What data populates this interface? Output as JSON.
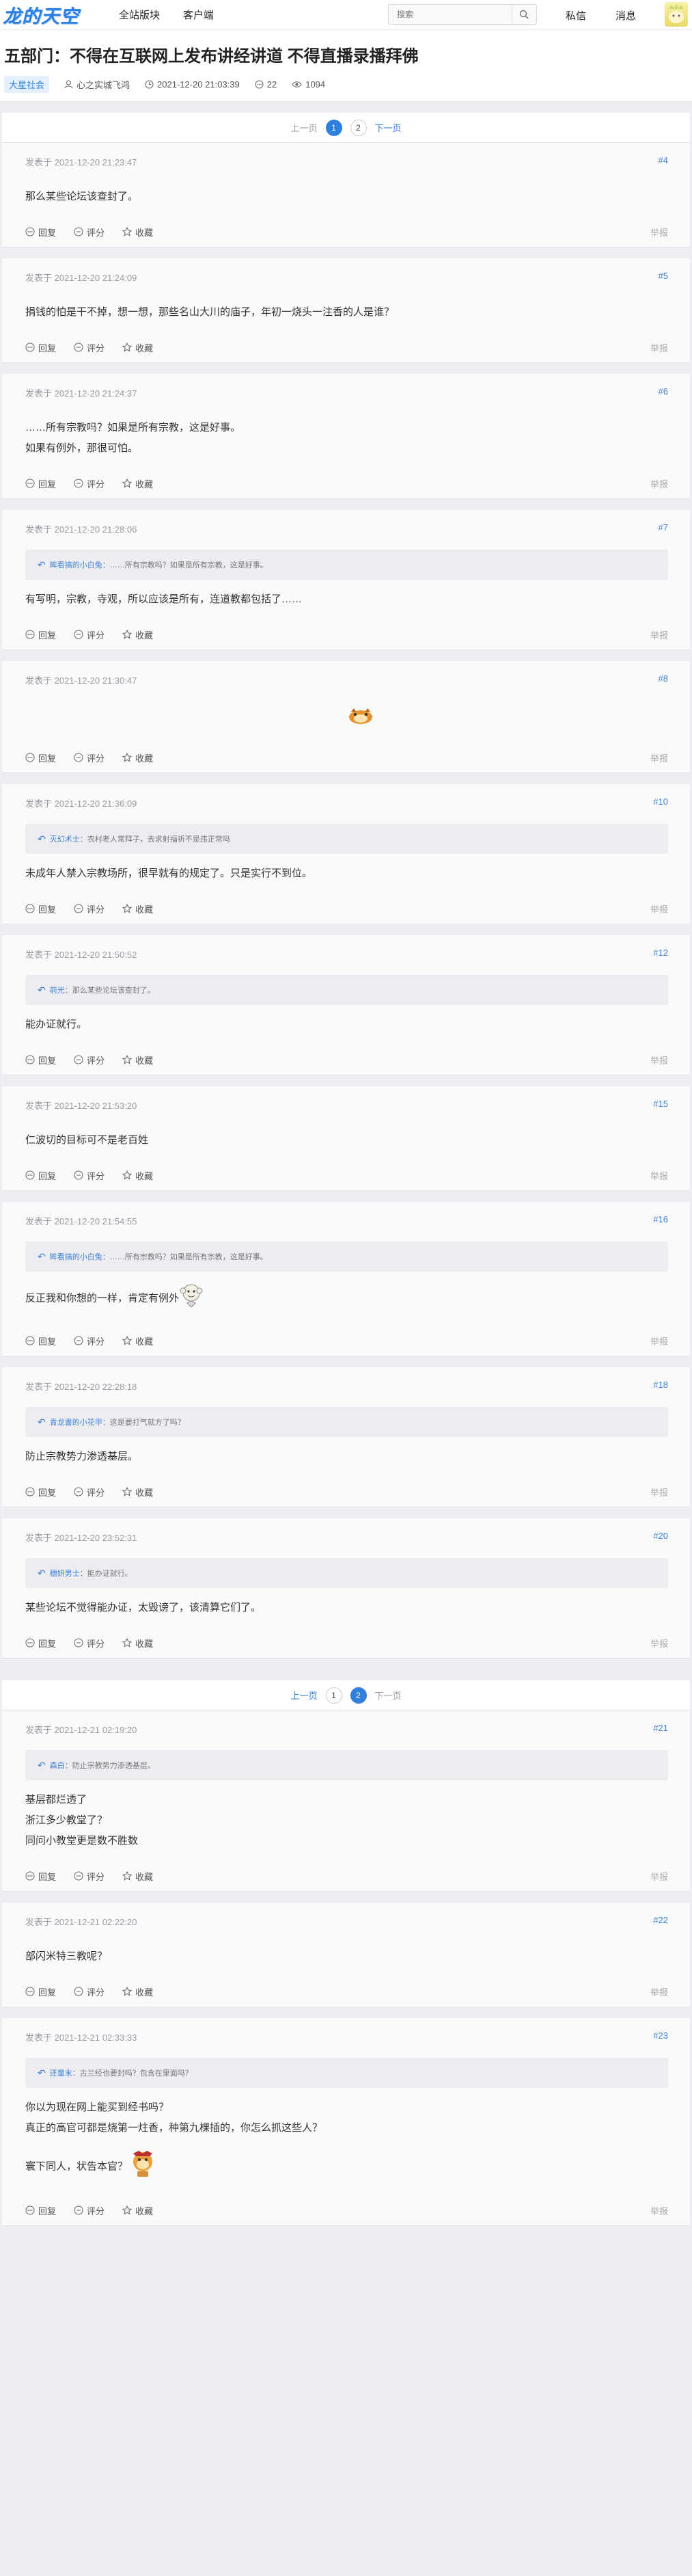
{
  "header": {
    "logo": "龙的天空",
    "nav": [
      "全站版块",
      "客户端"
    ],
    "search_placeholder": "搜索",
    "messages": "私信",
    "notifications": "消息"
  },
  "thread": {
    "title": "五部门：不得在互联网上发布讲经讲道 不得直播录播拜佛",
    "category": "大星社会",
    "author": "心之实城飞鸿",
    "datetime": "2021-12-20 21:03:39",
    "replies": "22",
    "views": "1094"
  },
  "pager1": {
    "prev": "上一页",
    "pages": [
      "1",
      "2"
    ],
    "active": "1",
    "next": "下一页"
  },
  "pager2": {
    "prev": "上一页",
    "pages": [
      "1",
      "2"
    ],
    "active": "2",
    "next": "下一页"
  },
  "actions": {
    "reply": "回复",
    "rate": "评分",
    "fav": "收藏",
    "report": "举报"
  },
  "posts": [
    {
      "time": "发表于 2021-12-20 21:23:47",
      "floor": "#4",
      "lines": [
        "那么某些论坛该查封了。"
      ]
    },
    {
      "time": "发表于 2021-12-20 21:24:09",
      "floor": "#5",
      "lines": [
        "捐钱的怕是干不掉，想一想，那些名山大川的庙子，年初一烧头一注香的人是谁？"
      ]
    },
    {
      "time": "发表于 2021-12-20 21:24:37",
      "floor": "#6",
      "lines": [
        "……所有宗教吗？如果是所有宗教，这是好事。",
        "如果有例外，那很可怕。"
      ]
    },
    {
      "time": "发表于 2021-12-20 21:28:06",
      "floor": "#7",
      "quote_name": "眸看搞的小白兔",
      "quote_text": "：……所有宗教吗？如果是所有宗教，这是好事。",
      "lines": [
        "有写明，宗教，寺观，所以应该是所有，连道教都包括了……"
      ]
    },
    {
      "time": "发表于 2021-12-20 21:30:47",
      "floor": "#8",
      "lines": [],
      "sticker": "tiger"
    },
    {
      "time": "发表于 2021-12-20 21:36:09",
      "floor": "#10",
      "quote_name": "灭幻术士",
      "quote_text": "：农村老人常拜子，去求射福祈不是违正常吗",
      "lines": [
        "未成年人禁入宗教场所，很早就有的规定了。只是实行不到位。"
      ]
    },
    {
      "time": "发表于 2021-12-20 21:50:52",
      "floor": "#12",
      "quote_name": "前光",
      "quote_text": "：那么某些论坛该查封了。",
      "lines": [
        "能办证就行。"
      ]
    },
    {
      "time": "发表于 2021-12-20 21:53:20",
      "floor": "#15",
      "lines": [
        "仁波切的目标可不是老百姓"
      ]
    },
    {
      "time": "发表于 2021-12-20 21:54:55",
      "floor": "#16",
      "quote_name": "眸看搞的小白兔",
      "quote_text": "：……所有宗教吗？如果是所有宗教，这是好事。",
      "lines": [
        "反正我和你想的一样，肯定有例外"
      ],
      "sticker": "monkey"
    },
    {
      "time": "发表于 2021-12-20 22:28:18",
      "floor": "#18",
      "quote_name": "青龙書的小花甲",
      "quote_text": "：这是要打气就方了吗？",
      "lines": [
        "防止宗教势力渗透基层。"
      ]
    },
    {
      "time": "发表于 2021-12-20 23:52:31",
      "floor": "#20",
      "quote_name": "穗妍男士",
      "quote_text": "：能办证就行。",
      "lines": [
        "某些论坛不觉得能办证，太毁谤了，该清算它们了。"
      ]
    },
    {
      "time": "发表于 2021-12-21 02:19:20",
      "floor": "#21",
      "quote_name": "森白",
      "quote_text": "：防止宗教势力渗透基层。",
      "lines": [
        "基层都烂透了",
        "浙江多少教堂了？",
        "同问小教堂更是数不胜数"
      ]
    },
    {
      "time": "发表于 2021-12-21 02:22:20",
      "floor": "#22",
      "lines": [
        "部闪米特三教呢？"
      ]
    },
    {
      "time": "发表于 2021-12-21 02:33:33",
      "floor": "#23",
      "quote_name": "还量末",
      "quote_text": "：古兰经也要封吗？包含在里面吗？",
      "lines": [
        "你以为现在网上能买到经书吗？",
        "真正的高官可都是烧第一炷香，种第九棵插的，你怎么抓这些人？",
        "",
        "寰下同人，状告本官？"
      ],
      "sticker": "monkey2"
    }
  ]
}
